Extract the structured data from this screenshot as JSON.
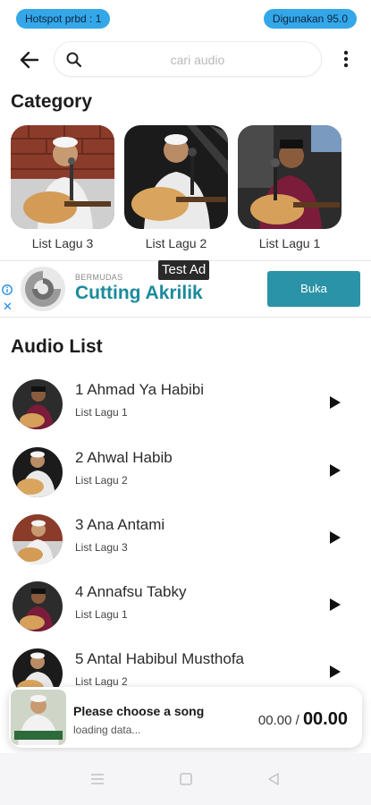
{
  "status": {
    "left_pill": "Hotspot prbd : 1",
    "right_pill": "Digunakan 95.0"
  },
  "topbar": {
    "search_placeholder": "cari audio",
    "back_icon": "back-arrow-icon",
    "more_icon": "more-vert-icon"
  },
  "category": {
    "title": "Category",
    "items": [
      {
        "label": "List Lagu 3"
      },
      {
        "label": "List Lagu 2"
      },
      {
        "label": "List Lagu 1"
      }
    ]
  },
  "ad": {
    "label": "Test Ad",
    "brand": "BERMUDAS",
    "headline": "Cutting Akrilik",
    "cta": "Buka",
    "close": "✕"
  },
  "audio_list": {
    "title": "Audio List",
    "items": [
      {
        "title": "1 Ahmad Ya Habibi",
        "subtitle": "List Lagu 1"
      },
      {
        "title": "2 Ahwal Habib",
        "subtitle": "List Lagu 2"
      },
      {
        "title": "3 Ana Antami",
        "subtitle": "List Lagu 3"
      },
      {
        "title": "4 Annafsu Tabky",
        "subtitle": "List Lagu 1"
      },
      {
        "title": "5 Antal Habibul Musthofa",
        "subtitle": "List Lagu 2"
      }
    ]
  },
  "player": {
    "title": "Please choose a song",
    "status": "loading data...",
    "elapsed": "00.00",
    "separator": "/",
    "total": "00.00"
  },
  "colors": {
    "pill": "#34a7e8",
    "ad_headline": "#1b8a9c",
    "ad_button": "#2b93a8"
  }
}
